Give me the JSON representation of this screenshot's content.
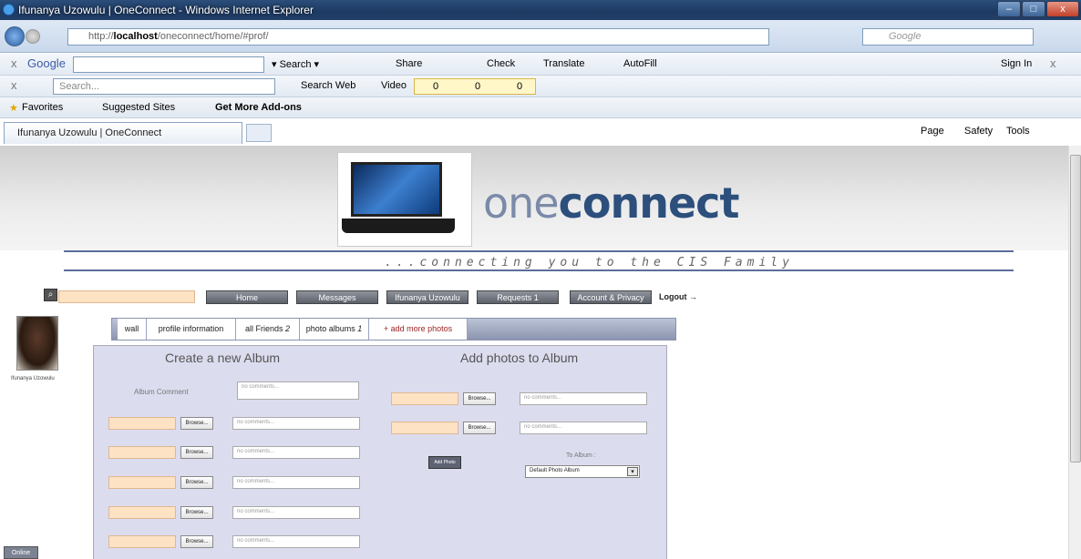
{
  "window": {
    "title": "Ifunanya Uzowulu | OneConnect - Windows Internet Explorer",
    "min": "–",
    "max": "□",
    "close": "x"
  },
  "address": {
    "url_prefix": "http://",
    "url_host": "localhost",
    "url_path": "/oneconnect/home/#prof/",
    "search_placeholder": "Google"
  },
  "gtoolbar": {
    "brand": "Google",
    "search": "Search",
    "share": "Share",
    "check": "Check",
    "translate": "Translate",
    "autofill": "AutoFill",
    "signin": "Sign In"
  },
  "sbtoolbar": {
    "search_placeholder": "Search...",
    "search_web": "Search Web",
    "video": "Video",
    "count_a": "0",
    "count_b": "0",
    "count_c": "0"
  },
  "favbar": {
    "favorites": "Favorites",
    "suggested": "Suggested Sites",
    "addons": "Get More Add-ons"
  },
  "tabbar": {
    "tab_title": "Ifunanya Uzowulu | OneConnect",
    "page": "Page",
    "safety": "Safety",
    "tools": "Tools"
  },
  "site": {
    "logo_light": "one",
    "logo_bold": "connect",
    "tagline": "...connecting you to the CIS Family"
  },
  "nav": {
    "home": "Home",
    "messages": "Messages",
    "user": "Ifunanya Uzowulu",
    "requests": "Requests 1",
    "account": "Account & Privacy",
    "logout": "Logout"
  },
  "profile": {
    "name": "Ifunanya Uzowulu",
    "online": "Online"
  },
  "tabs": {
    "wall": "wall",
    "info": "profile information",
    "friends": "all Friends",
    "friends_count": "2",
    "albums": "photo albums",
    "albums_count": "1",
    "add": "+ add more photos"
  },
  "create": {
    "heading": "Create a new Album",
    "comment_label": "Album Comment",
    "comment_placeholder": "no comments...",
    "browse": "Browse...",
    "row_placeholder": "no comments..."
  },
  "add": {
    "heading": "Add photos to Album",
    "browse": "Browse...",
    "row_placeholder": "no comments...",
    "add_photo": "Add Photo",
    "to_album": "To Album :",
    "selected_album": "Default Photo Album"
  }
}
